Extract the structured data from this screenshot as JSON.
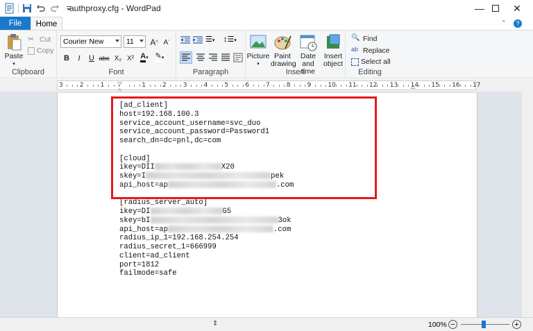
{
  "window": {
    "title": "authproxy.cfg - WordPad",
    "minimize_icon": "minimize-icon",
    "maximize_icon": "maximize-icon",
    "close_icon": "close-icon"
  },
  "tabs": {
    "file": "File",
    "home": "Home"
  },
  "ribbon": {
    "clipboard": {
      "label": "Clipboard",
      "paste": "Paste",
      "cut": "Cut",
      "copy": "Copy"
    },
    "font": {
      "label": "Font",
      "family": "Courier New",
      "size": "11",
      "bold": "B",
      "italic": "I",
      "underline": "U",
      "strike": "abc",
      "subscript": "X₂",
      "superscript": "X²",
      "grow": "A",
      "shrink": "A"
    },
    "paragraph": {
      "label": "Paragraph"
    },
    "insert": {
      "label": "Insert",
      "picture": "Picture",
      "paint_drawing": "Paint drawing",
      "date_time": "Date and time",
      "insert_object": "Insert object"
    },
    "editing": {
      "label": "Editing",
      "find": "Find",
      "replace": "Replace",
      "select_all": "Select all"
    }
  },
  "ruler": {
    "labels": [
      "3",
      "2",
      "1",
      "",
      "1",
      "2",
      "3",
      "4",
      "5",
      "6",
      "7",
      "8",
      "9",
      "10",
      "11",
      "12",
      "13",
      "14",
      "15",
      "16",
      "17"
    ]
  },
  "document": {
    "lines": [
      {
        "text": "[ad_client]"
      },
      {
        "text": "host=192.168.100.3"
      },
      {
        "text": "service_account_username=svc_duo"
      },
      {
        "text": "service_account_password=Password1"
      },
      {
        "text": "search_dn=dc=pnl,dc=com"
      },
      {
        "text": ""
      },
      {
        "text": "[cloud]"
      },
      {
        "text": "ikey=DII",
        "tail": "X20"
      },
      {
        "text": "skey=I",
        "tail": "pek"
      },
      {
        "text": "api_host=ap",
        "tail": ".com"
      },
      {
        "text": ""
      },
      {
        "text": "[radius_server_auto]"
      },
      {
        "text": "ikey=DI",
        "tail": "G5"
      },
      {
        "text": "skey=bI",
        "tail": "3ok"
      },
      {
        "text": "api_host=ap",
        "tail": ".com"
      },
      {
        "text": "radius_ip_1=192.168.254.254"
      },
      {
        "text": "radius_secret_1=666999"
      },
      {
        "text": "client=ad_client"
      },
      {
        "text": "port=1812"
      },
      {
        "text": "failmode=safe"
      }
    ]
  },
  "status": {
    "zoom": "100%",
    "zoom_out": "−",
    "zoom_in": "+"
  },
  "colors": {
    "accent": "#1979ca",
    "highlight": "#e31a1c"
  }
}
